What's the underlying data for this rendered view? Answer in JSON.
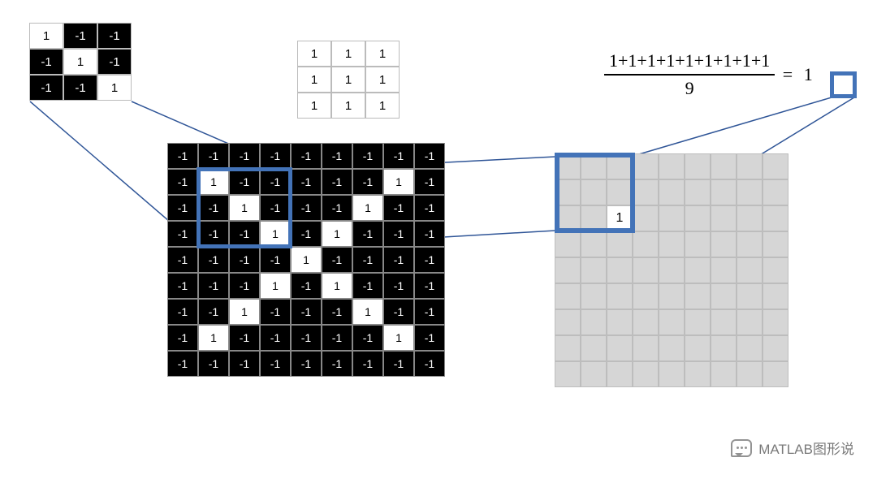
{
  "filter3x3": [
    [
      {
        "v": "1",
        "c": "w"
      },
      {
        "v": "-1",
        "c": "b"
      },
      {
        "v": "-1",
        "c": "b"
      }
    ],
    [
      {
        "v": "-1",
        "c": "b"
      },
      {
        "v": "1",
        "c": "w"
      },
      {
        "v": "-1",
        "c": "b"
      }
    ],
    [
      {
        "v": "-1",
        "c": "b"
      },
      {
        "v": "-1",
        "c": "b"
      },
      {
        "v": "1",
        "c": "w"
      }
    ]
  ],
  "ones3x3": [
    [
      "1",
      "1",
      "1"
    ],
    [
      "1",
      "1",
      "1"
    ],
    [
      "1",
      "1",
      "1"
    ]
  ],
  "big9x9": [
    [
      {
        "v": "-1",
        "c": "b"
      },
      {
        "v": "-1",
        "c": "b"
      },
      {
        "v": "-1",
        "c": "b"
      },
      {
        "v": "-1",
        "c": "b"
      },
      {
        "v": "-1",
        "c": "b"
      },
      {
        "v": "-1",
        "c": "b"
      },
      {
        "v": "-1",
        "c": "b"
      },
      {
        "v": "-1",
        "c": "b"
      },
      {
        "v": "-1",
        "c": "b"
      }
    ],
    [
      {
        "v": "-1",
        "c": "b"
      },
      {
        "v": "1",
        "c": "w"
      },
      {
        "v": "-1",
        "c": "b"
      },
      {
        "v": "-1",
        "c": "b"
      },
      {
        "v": "-1",
        "c": "b"
      },
      {
        "v": "-1",
        "c": "b"
      },
      {
        "v": "-1",
        "c": "b"
      },
      {
        "v": "1",
        "c": "w"
      },
      {
        "v": "-1",
        "c": "b"
      }
    ],
    [
      {
        "v": "-1",
        "c": "b"
      },
      {
        "v": "-1",
        "c": "b"
      },
      {
        "v": "1",
        "c": "w"
      },
      {
        "v": "-1",
        "c": "b"
      },
      {
        "v": "-1",
        "c": "b"
      },
      {
        "v": "-1",
        "c": "b"
      },
      {
        "v": "1",
        "c": "w"
      },
      {
        "v": "-1",
        "c": "b"
      },
      {
        "v": "-1",
        "c": "b"
      }
    ],
    [
      {
        "v": "-1",
        "c": "b"
      },
      {
        "v": "-1",
        "c": "b"
      },
      {
        "v": "-1",
        "c": "b"
      },
      {
        "v": "1",
        "c": "w"
      },
      {
        "v": "-1",
        "c": "b"
      },
      {
        "v": "1",
        "c": "w"
      },
      {
        "v": "-1",
        "c": "b"
      },
      {
        "v": "-1",
        "c": "b"
      },
      {
        "v": "-1",
        "c": "b"
      }
    ],
    [
      {
        "v": "-1",
        "c": "b"
      },
      {
        "v": "-1",
        "c": "b"
      },
      {
        "v": "-1",
        "c": "b"
      },
      {
        "v": "-1",
        "c": "b"
      },
      {
        "v": "1",
        "c": "w"
      },
      {
        "v": "-1",
        "c": "b"
      },
      {
        "v": "-1",
        "c": "b"
      },
      {
        "v": "-1",
        "c": "b"
      },
      {
        "v": "-1",
        "c": "b"
      }
    ],
    [
      {
        "v": "-1",
        "c": "b"
      },
      {
        "v": "-1",
        "c": "b"
      },
      {
        "v": "-1",
        "c": "b"
      },
      {
        "v": "1",
        "c": "w"
      },
      {
        "v": "-1",
        "c": "b"
      },
      {
        "v": "1",
        "c": "w"
      },
      {
        "v": "-1",
        "c": "b"
      },
      {
        "v": "-1",
        "c": "b"
      },
      {
        "v": "-1",
        "c": "b"
      }
    ],
    [
      {
        "v": "-1",
        "c": "b"
      },
      {
        "v": "-1",
        "c": "b"
      },
      {
        "v": "1",
        "c": "w"
      },
      {
        "v": "-1",
        "c": "b"
      },
      {
        "v": "-1",
        "c": "b"
      },
      {
        "v": "-1",
        "c": "b"
      },
      {
        "v": "1",
        "c": "w"
      },
      {
        "v": "-1",
        "c": "b"
      },
      {
        "v": "-1",
        "c": "b"
      }
    ],
    [
      {
        "v": "-1",
        "c": "b"
      },
      {
        "v": "1",
        "c": "w"
      },
      {
        "v": "-1",
        "c": "b"
      },
      {
        "v": "-1",
        "c": "b"
      },
      {
        "v": "-1",
        "c": "b"
      },
      {
        "v": "-1",
        "c": "b"
      },
      {
        "v": "-1",
        "c": "b"
      },
      {
        "v": "1",
        "c": "w"
      },
      {
        "v": "-1",
        "c": "b"
      }
    ],
    [
      {
        "v": "-1",
        "c": "b"
      },
      {
        "v": "-1",
        "c": "b"
      },
      {
        "v": "-1",
        "c": "b"
      },
      {
        "v": "-1",
        "c": "b"
      },
      {
        "v": "-1",
        "c": "b"
      },
      {
        "v": "-1",
        "c": "b"
      },
      {
        "v": "-1",
        "c": "b"
      },
      {
        "v": "-1",
        "c": "b"
      },
      {
        "v": "-1",
        "c": "b"
      }
    ]
  ],
  "output": {
    "rows": 9,
    "cols": 9,
    "value_cell": {
      "row": 2,
      "col": 2,
      "value": "1"
    }
  },
  "formula": {
    "numerator": "1+1+1+1+1+1+1+1+1",
    "denominator": "9",
    "equals": "=",
    "result": "1"
  },
  "watermark": "MATLAB图形说",
  "colors": {
    "highlight": "#4373b8",
    "line": "#2f5597",
    "grid_gray": "#d6d6d6"
  },
  "chart_data": {
    "type": "table",
    "description": "CNN convolution illustration: 3x3 diagonal filter applied to 9x9 X-pattern produces convolution map; highlighted region elementwise-multiplied sums to 9, divided by 9 equals 1.",
    "filter": [
      [
        1,
        -1,
        -1
      ],
      [
        -1,
        1,
        -1
      ],
      [
        -1,
        -1,
        1
      ]
    ],
    "ones_mask": [
      [
        1,
        1,
        1
      ],
      [
        1,
        1,
        1
      ],
      [
        1,
        1,
        1
      ]
    ],
    "input": [
      [
        -1,
        -1,
        -1,
        -1,
        -1,
        -1,
        -1,
        -1,
        -1
      ],
      [
        -1,
        1,
        -1,
        -1,
        -1,
        -1,
        -1,
        1,
        -1
      ],
      [
        -1,
        -1,
        1,
        -1,
        -1,
        -1,
        1,
        -1,
        -1
      ],
      [
        -1,
        -1,
        -1,
        1,
        -1,
        1,
        -1,
        -1,
        -1
      ],
      [
        -1,
        -1,
        -1,
        -1,
        1,
        -1,
        -1,
        -1,
        -1
      ],
      [
        -1,
        -1,
        -1,
        1,
        -1,
        1,
        -1,
        -1,
        -1
      ],
      [
        -1,
        -1,
        1,
        -1,
        -1,
        -1,
        1,
        -1,
        -1
      ],
      [
        -1,
        1,
        -1,
        -1,
        -1,
        -1,
        -1,
        1,
        -1
      ],
      [
        -1,
        -1,
        -1,
        -1,
        -1,
        -1,
        -1,
        -1,
        -1
      ]
    ],
    "output_known": {
      "row": 2,
      "col": 2,
      "value": 1
    },
    "computation": {
      "sum": 9,
      "divisor": 9,
      "result": 1
    }
  }
}
